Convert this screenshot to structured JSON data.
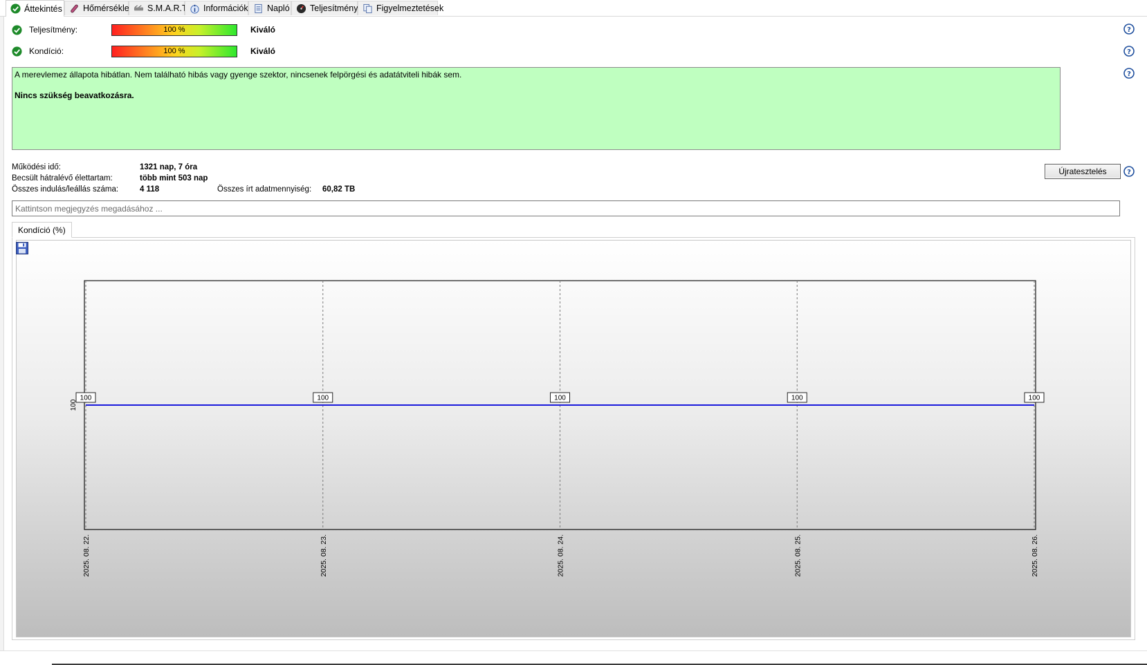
{
  "tabs": [
    {
      "label": "Áttekintés",
      "icon": "check-circle-icon",
      "active": true
    },
    {
      "label": "Hőmérséklet",
      "icon": "thermometer-icon"
    },
    {
      "label": "S.M.A.R.T.",
      "icon": "smart-drive-icon"
    },
    {
      "label": "Információk",
      "icon": "info-icon"
    },
    {
      "label": "Napló",
      "icon": "log-icon"
    },
    {
      "label": "Teljesítmény",
      "icon": "gauge-icon"
    },
    {
      "label": "Figyelmeztetések",
      "icon": "warnings-icon"
    }
  ],
  "status": {
    "performance": {
      "label": "Teljesítmény:",
      "percent_text": "100 %",
      "percent": 100,
      "rating": "Kiváló"
    },
    "condition": {
      "label": "Kondíció:",
      "percent_text": "100 %",
      "percent": 100,
      "rating": "Kiváló"
    }
  },
  "message": {
    "line1": "A merevlemez állapota hibátlan. Nem található hibás vagy gyenge szektor, nincsenek felpörgési és adatátviteli hibák sem.",
    "line2": "Nincs szükség beavatkozásra.",
    "background": "#bfffc0"
  },
  "stats": {
    "uptime_label": "Működési idő:",
    "uptime_value": "1321 nap, 7 óra",
    "remaining_label": "Becsült hátralévő élettartam:",
    "remaining_value": "több mint 503 nap",
    "startstop_label": "Összes indulás/leállás száma:",
    "startstop_value": "4 118",
    "written_label": "Összes írt adatmennyiség:",
    "written_value": "60,82 TB"
  },
  "retest_label": "Újratesztelés",
  "note_placeholder": "Kattintson megjegyzés megadásához ...",
  "chart_tab_label": "Kondíció  (%)",
  "chart_data": {
    "type": "line",
    "x": [
      "2025. 08. 22.",
      "2025. 08. 23.",
      "2025. 08. 24.",
      "2025. 08. 25.",
      "2025. 08. 26."
    ],
    "series": [
      {
        "values": [
          100,
          100,
          100,
          100,
          100
        ],
        "color": "#1a1adc"
      }
    ],
    "y_tick_labels": [
      "100"
    ],
    "grid": true,
    "line_color": "#1a1adc"
  }
}
